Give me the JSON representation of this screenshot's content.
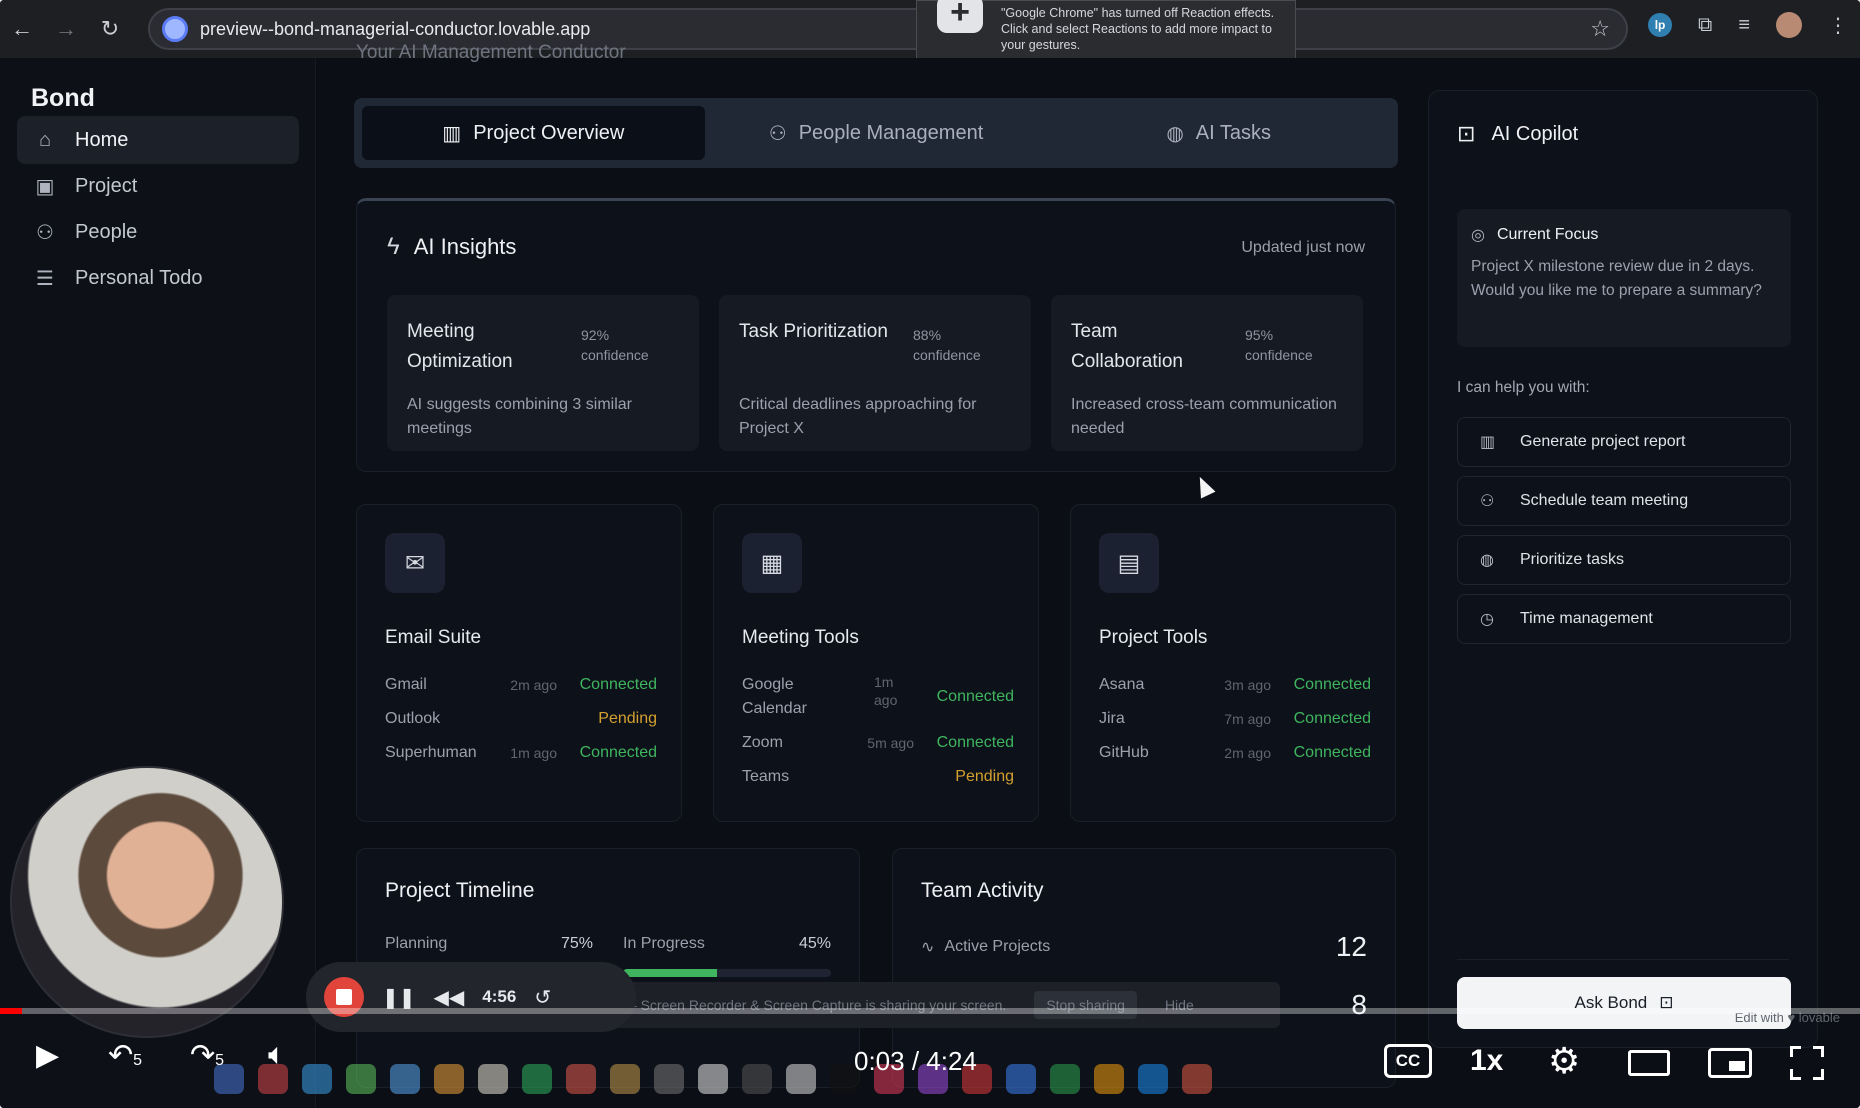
{
  "browser": {
    "url": "preview--bond-managerial-conductor.lovable.app",
    "notification": "\"Google Chrome\" has turned off Reaction effects. Click  and select Reactions to add more impact to your gestures."
  },
  "app": {
    "brand": "Bond",
    "subtitle": "Your AI Management Conductor",
    "sidebar": [
      {
        "label": "Home",
        "icon": "home-icon"
      },
      {
        "label": "Project",
        "icon": "folder-icon"
      },
      {
        "label": "People",
        "icon": "users-icon"
      },
      {
        "label": "Personal Todo",
        "icon": "list-icon"
      }
    ],
    "tabs": [
      {
        "label": "Project Overview",
        "icon": "bar-chart-icon"
      },
      {
        "label": "People Management",
        "icon": "users-icon"
      },
      {
        "label": "AI Tasks",
        "icon": "brain-icon"
      }
    ],
    "insights": {
      "title": "AI Insights",
      "updated": "Updated just now",
      "cards": [
        {
          "title": "Meeting Optimization",
          "confidence": "92%",
          "confidence_label": "confidence",
          "desc": "AI suggests combining 3 similar meetings"
        },
        {
          "title": "Task Prioritization",
          "confidence": "88%",
          "confidence_label": "confidence",
          "desc": "Critical deadlines approaching for Project X"
        },
        {
          "title": "Team Collaboration",
          "confidence": "95%",
          "confidence_label": "confidence",
          "desc": "Increased cross-team communication needed"
        }
      ]
    },
    "tools": [
      {
        "name": "Email Suite",
        "icon": "mail-icon",
        "rows": [
          {
            "name": "Gmail",
            "ago": "2m ago",
            "status": "Connected"
          },
          {
            "name": "Outlook",
            "ago": "",
            "status": "Pending"
          },
          {
            "name": "Superhuman",
            "ago": "1m ago",
            "status": "Connected"
          }
        ]
      },
      {
        "name": "Meeting Tools",
        "icon": "calendar-icon",
        "rows": [
          {
            "name": "Google Calendar",
            "ago": "1m ago",
            "status": "Connected"
          },
          {
            "name": "Zoom",
            "ago": "5m ago",
            "status": "Connected"
          },
          {
            "name": "Teams",
            "ago": "",
            "status": "Pending"
          }
        ]
      },
      {
        "name": "Project Tools",
        "icon": "briefcase-icon",
        "rows": [
          {
            "name": "Asana",
            "ago": "3m ago",
            "status": "Connected"
          },
          {
            "name": "Jira",
            "ago": "7m ago",
            "status": "Connected"
          },
          {
            "name": "GitHub",
            "ago": "2m ago",
            "status": "Connected"
          }
        ]
      }
    ],
    "timeline": {
      "title": "Project Timeline",
      "items": [
        {
          "label": "Planning",
          "value": "75%",
          "progress": 0.75
        },
        {
          "label": "In Progress",
          "value": "45%",
          "progress": 0.45
        }
      ]
    },
    "activity": {
      "title": "Team Activity",
      "items": [
        {
          "label": "Active Projects",
          "value": "12"
        },
        {
          "label": "",
          "value": "8"
        }
      ]
    },
    "copilot": {
      "title": "AI Copilot",
      "focus_title": "Current Focus",
      "focus_text": "Project X milestone review due in 2 days. Would you like me to prepare a summary?",
      "help_label": "I can help you with:",
      "actions": [
        {
          "label": "Generate project report",
          "icon": "bar-chart-icon"
        },
        {
          "label": "Schedule team meeting",
          "icon": "users-icon"
        },
        {
          "label": "Prioritize tasks",
          "icon": "brain-icon"
        },
        {
          "label": "Time management",
          "icon": "clock-icon"
        }
      ],
      "ask_label": "Ask Bond"
    }
  },
  "loom": {
    "timer": "4:56",
    "share_text": "Loom – Screen Recorder & Screen Capture is sharing your screen.",
    "stop_label": "Stop sharing",
    "hide_label": "Hide",
    "edit_with": "Edit with ♥ lovable"
  },
  "player": {
    "time": "0:03 / 4:24",
    "skip_back": "5",
    "skip_fwd": "5",
    "cc": "CC",
    "speed": "1x",
    "progress": 0.012
  },
  "colors": {
    "connected": "#3fb55f",
    "pending": "#d4a02f",
    "accent": "#3b4bd1",
    "progress": "#ff0000"
  }
}
